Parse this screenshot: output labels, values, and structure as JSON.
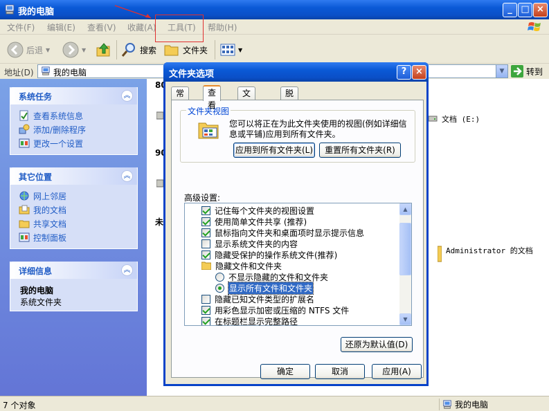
{
  "window": {
    "title": "我的电脑",
    "controls": {
      "minimize": "_",
      "maximize": "□",
      "close": "×"
    }
  },
  "menubar": {
    "items": [
      "文件(F)",
      "编辑(E)",
      "查看(V)",
      "收藏(A)",
      "工具(T)",
      "帮助(H)"
    ]
  },
  "toolbar": {
    "back_label": "后退",
    "search_label": "搜索",
    "folders_label": "文件夹"
  },
  "addressbar": {
    "label": "地址(D)",
    "value": "我的电脑",
    "go_label": "转到"
  },
  "leftpane": {
    "system_tasks": {
      "title": "系统任务",
      "items": [
        "查看系统信息",
        "添加/删除程序",
        "更改一个设置"
      ]
    },
    "other_places": {
      "title": "其它位置",
      "items": [
        "网上邻居",
        "我的文档",
        "共享文档",
        "控制面板"
      ]
    },
    "details": {
      "title": "详细信息",
      "name": "我的电脑",
      "subtitle": "系统文件夹"
    }
  },
  "main": {
    "group_heads": [
      "80",
      "90",
      "未"
    ],
    "items": [
      {
        "label": "文档 (E:)"
      },
      {
        "label": "Administrator 的文档"
      }
    ]
  },
  "statusbar": {
    "left": "7 个对象",
    "right": "我的电脑"
  },
  "dialog": {
    "title": "文件夹选项",
    "help": "?",
    "close": "×",
    "tabs": [
      "常规",
      "查看",
      "文件类型",
      "脱机文件"
    ],
    "active_tab": "查看",
    "folder_views": {
      "title": "文件夹视图",
      "description": "您可以将正在为此文件夹使用的视图(例如详细信息或平铺)应用到所有文件夹。",
      "apply_all_button": "应用到所有文件夹(L)",
      "reset_all_button": "重置所有文件夹(R)"
    },
    "advanced_label": "高级设置:",
    "settings": [
      {
        "type": "checkbox",
        "checked": true,
        "label": "记住每个文件夹的视图设置"
      },
      {
        "type": "checkbox",
        "checked": true,
        "label": "使用简单文件共享 (推荐)"
      },
      {
        "type": "checkbox",
        "checked": true,
        "label": "鼠标指向文件夹和桌面项时显示提示信息"
      },
      {
        "type": "checkbox",
        "checked": false,
        "label": "显示系统文件夹的内容"
      },
      {
        "type": "checkbox",
        "checked": true,
        "label": "隐藏受保护的操作系统文件(推荐)"
      },
      {
        "type": "folder",
        "label": "隐藏文件和文件夹"
      },
      {
        "type": "radio",
        "checked": false,
        "label": "不显示隐藏的文件和文件夹"
      },
      {
        "type": "radio",
        "checked": true,
        "label": "显示所有文件和文件夹"
      },
      {
        "type": "checkbox",
        "checked": false,
        "label": "隐藏已知文件类型的扩展名"
      },
      {
        "type": "checkbox",
        "checked": true,
        "label": "用彩色显示加密或压缩的 NTFS 文件"
      },
      {
        "type": "checkbox",
        "checked": true,
        "label": "在标题栏显示完整路径"
      }
    ],
    "restore_defaults_button": "还原为默认值(D)",
    "ok_button": "确定",
    "cancel_button": "取消",
    "apply_button": "应用(A)"
  },
  "colors": {
    "titlebar": "#0a59d6",
    "highlight": "#e03030",
    "link": "#215dc6",
    "selection": "#316ac5"
  }
}
